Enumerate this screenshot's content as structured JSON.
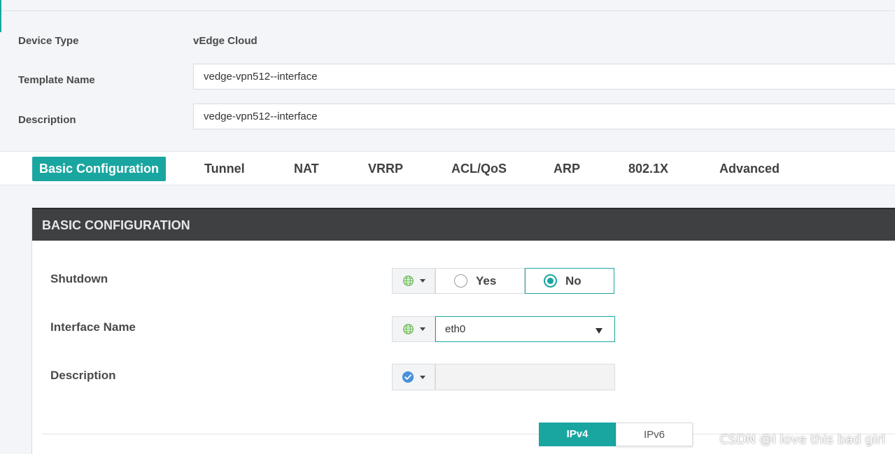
{
  "meta": {
    "device_type_label": "Device Type",
    "device_type_value": "vEdge Cloud",
    "template_name_label": "Template Name",
    "template_name_value": "vedge-vpn512--interface",
    "description_label": "Description",
    "description_value": "vedge-vpn512--interface"
  },
  "tabs": [
    {
      "label": "Basic Configuration",
      "active": true
    },
    {
      "label": "Tunnel"
    },
    {
      "label": "NAT"
    },
    {
      "label": "VRRP"
    },
    {
      "label": "ACL/QoS"
    },
    {
      "label": "ARP"
    },
    {
      "label": "802.1X"
    },
    {
      "label": "Advanced"
    }
  ],
  "panel": {
    "title": "BASIC CONFIGURATION",
    "shutdown": {
      "label": "Shutdown",
      "scope_icon": "globe-icon",
      "options": [
        "Yes",
        "No"
      ],
      "selected": "No"
    },
    "interface_name": {
      "label": "Interface Name",
      "scope_icon": "globe-icon",
      "value": "eth0"
    },
    "description": {
      "label": "Description",
      "scope_icon": "check-circle-icon",
      "value": ""
    },
    "ip_tabs": [
      {
        "label": "IPv4",
        "active": true
      },
      {
        "label": "IPv6"
      }
    ]
  },
  "watermark": "CSDN @I love this bad girl",
  "colors": {
    "accent": "#1aa6a0",
    "header": "#3f4042",
    "globe": "#6fbf5a",
    "check": "#4a90d9"
  }
}
